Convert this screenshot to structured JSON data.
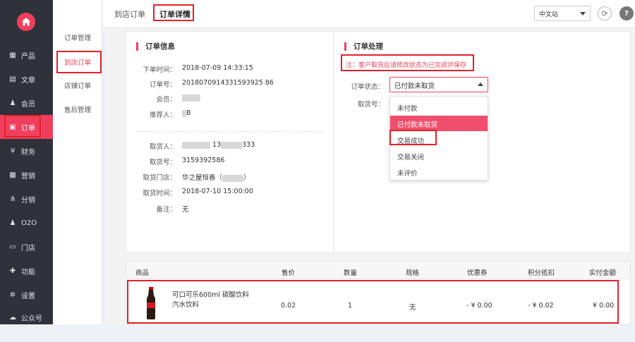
{
  "sidebar": {
    "items": [
      {
        "icon": "grid-icon",
        "label": "产品"
      },
      {
        "icon": "document-icon",
        "label": "文章"
      },
      {
        "icon": "user-icon",
        "label": "会员"
      },
      {
        "icon": "order-icon",
        "label": "订单"
      },
      {
        "icon": "yen-icon",
        "label": "财务"
      },
      {
        "icon": "gift-icon",
        "label": "营销"
      },
      {
        "icon": "network-icon",
        "label": "分销"
      },
      {
        "icon": "o2o-icon",
        "label": "O2O"
      },
      {
        "icon": "store-icon",
        "label": "门店"
      },
      {
        "icon": "puzzle-icon",
        "label": "功能"
      },
      {
        "icon": "gear-icon",
        "label": "设置"
      },
      {
        "icon": "wechat-icon",
        "label": "公众号"
      }
    ]
  },
  "submenu": {
    "items": [
      "订单管理",
      "到店订单",
      "店铺订单",
      "售后管理"
    ]
  },
  "topbar": {
    "tabs": [
      "到店订单",
      "订单详情"
    ],
    "language": "中文站"
  },
  "order_info": {
    "title": "订单信息",
    "fields": [
      {
        "label": "下单时间：",
        "value": "2018-07-09 14:33:15"
      },
      {
        "label": "订单号：",
        "value": "20180709143315939 2586"
      },
      {
        "label": "会员：",
        "value": ""
      },
      {
        "label": "推荐人：",
        "value": "B"
      }
    ],
    "pickup": [
      {
        "label": "取货人：",
        "value_a": "13",
        "value_b": "333"
      },
      {
        "label": "取货号：",
        "value": "3159392586"
      },
      {
        "label": "取货门店：",
        "value": "华之屋恒香（"
      },
      {
        "label": "取货时间：",
        "value": "2018-07-10 15:00:00"
      },
      {
        "label": "备注：",
        "value": "无"
      }
    ]
  },
  "order_process": {
    "title": "订单处理",
    "notice": "注：客户取货后请修改状态为已完成并保存",
    "status_label": "订单状态：",
    "status_value": "已付款未取货",
    "pickup_no_label": "取货号：",
    "options": [
      "未付款",
      "已付款未取货",
      "交易成功",
      "交易关闭",
      "未评价"
    ]
  },
  "goods_table": {
    "headers": [
      "商品",
      "售价",
      "数量",
      "规格",
      "优惠券",
      "积分抵扣",
      "实付金额"
    ],
    "rows": [
      {
        "name_line1": "可口可乐600ml 碳酸饮料",
        "name_line2": "汽水饮料",
        "price": "0.02",
        "qty": "1",
        "spec": "无",
        "coupon": "- ¥ 0.00",
        "points": "- ¥ 0.02",
        "paid": "¥ 0.00"
      }
    ]
  },
  "colors": {
    "accent": "#ef3f5c",
    "sidebar_bg": "#2f323a",
    "highlight_border": "#e0222b"
  }
}
